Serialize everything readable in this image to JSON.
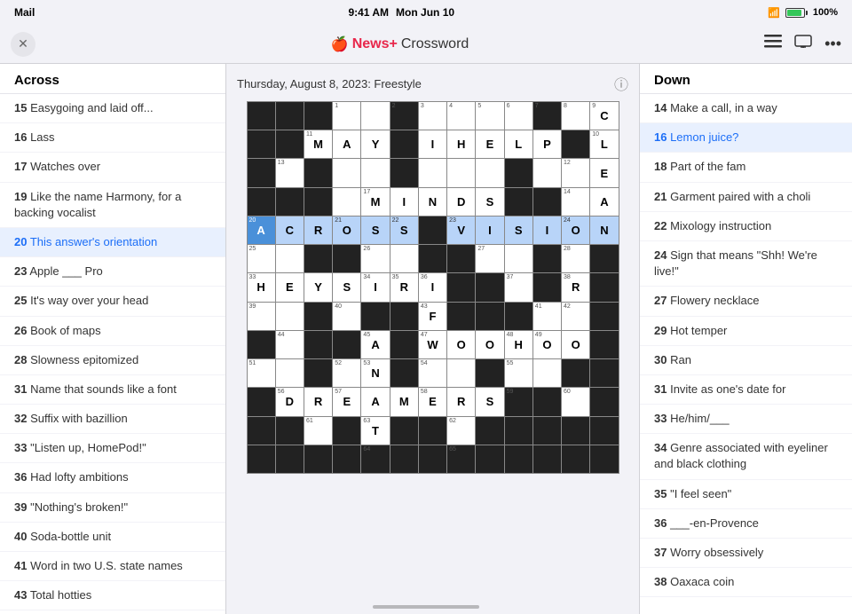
{
  "statusBar": {
    "left": "Mail",
    "time": "9:41 AM",
    "date": "Mon Jun 10",
    "dots": "• • •",
    "wifi": "WiFi",
    "battery": "100%"
  },
  "toolbar": {
    "closeBtn": "✕",
    "appLogo": "",
    "appNewsPlus": "News+",
    "appCrossword": " Crossword",
    "listIcon": "☰",
    "userIcon": "⊡",
    "moreIcon": "•••"
  },
  "grid": {
    "date": "Thursday, August 8, 2023: Freestyle",
    "infoIcon": "ⓘ"
  },
  "acrossPanel": {
    "header": "Across",
    "clues": [
      {
        "num": "15",
        "text": "Easygoing and laid off..."
      },
      {
        "num": "16",
        "text": "Lass"
      },
      {
        "num": "17",
        "text": "Watches over"
      },
      {
        "num": "19",
        "text": "Like the name Harmony, for a backing vocalist"
      },
      {
        "num": "20",
        "text": "This answer's orientation",
        "active": true
      },
      {
        "num": "23",
        "text": "Apple ___ Pro"
      },
      {
        "num": "25",
        "text": "It's way over your head"
      },
      {
        "num": "26",
        "text": "Book of maps"
      },
      {
        "num": "28",
        "text": "Slowness epitomized"
      },
      {
        "num": "31",
        "text": "Name that sounds like a font"
      },
      {
        "num": "32",
        "text": "Suffix with bazillion"
      },
      {
        "num": "33",
        "text": "\"Listen up, HomePod!\""
      },
      {
        "num": "36",
        "text": "Had lofty ambitions"
      },
      {
        "num": "39",
        "text": "\"Nothing's broken!\""
      },
      {
        "num": "40",
        "text": "Soda-bottle unit"
      },
      {
        "num": "41",
        "text": "Word in two U.S. state names"
      },
      {
        "num": "43",
        "text": "Total hotties"
      }
    ]
  },
  "downPanel": {
    "header": "Down",
    "clues": [
      {
        "num": "14",
        "text": "Make a call, in a way"
      },
      {
        "num": "16",
        "text": "Lemon juice?",
        "highlighted": true
      },
      {
        "num": "18",
        "text": "Part of the fam"
      },
      {
        "num": "21",
        "text": "Garment paired with a choli"
      },
      {
        "num": "22",
        "text": "Mixology instruction"
      },
      {
        "num": "24",
        "text": "Sign that means \"Shh! We're live!\""
      },
      {
        "num": "27",
        "text": "Flowery necklace"
      },
      {
        "num": "29",
        "text": "Hot temper"
      },
      {
        "num": "30",
        "text": "Ran"
      },
      {
        "num": "31",
        "text": "Invite as one's date for"
      },
      {
        "num": "33",
        "text": "He/him/___"
      },
      {
        "num": "34",
        "text": "Genre associated with eyeliner and black clothing"
      },
      {
        "num": "35",
        "text": "\"I feel seen\""
      },
      {
        "num": "36",
        "text": "___-en-Provence"
      },
      {
        "num": "37",
        "text": "Worry obsessively"
      },
      {
        "num": "38",
        "text": "Oaxaca coin"
      }
    ]
  },
  "cells": {
    "gridData": "see_template"
  }
}
